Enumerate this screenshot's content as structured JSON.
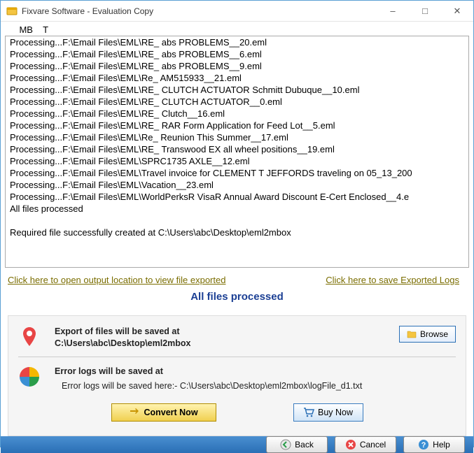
{
  "window": {
    "title": "Fixvare Software - Evaluation Copy"
  },
  "log": {
    "header_clip": "    MB    T",
    "lines": [
      "Processing...F:\\Email Files\\EML\\RE_ abs PROBLEMS__20.eml",
      "Processing...F:\\Email Files\\EML\\RE_ abs PROBLEMS__6.eml",
      "Processing...F:\\Email Files\\EML\\RE_ abs PROBLEMS__9.eml",
      "Processing...F:\\Email Files\\EML\\Re_ AM515933__21.eml",
      "Processing...F:\\Email Files\\EML\\RE_ CLUTCH ACTUATOR Schmitt Dubuque__10.eml",
      "Processing...F:\\Email Files\\EML\\RE_ CLUTCH ACTUATOR__0.eml",
      "Processing...F:\\Email Files\\EML\\RE_ Clutch__16.eml",
      "Processing...F:\\Email Files\\EML\\RE_ RAR Form Application for Feed Lot__5.eml",
      "Processing...F:\\Email Files\\EML\\Re_ Reunion This Summer__17.eml",
      "Processing...F:\\Email Files\\EML\\RE_ Transwood EX all wheel positions__19.eml",
      "Processing...F:\\Email Files\\EML\\SPRC1735 AXLE__12.eml",
      "Processing...F:\\Email Files\\EML\\Travel invoice for CLEMENT T JEFFORDS traveling on 05_13_200",
      "Processing...F:\\Email Files\\EML\\Vacation__23.eml",
      "Processing...F:\\Email Files\\EML\\WorldPerksR VisaR Annual Award Discount E-Cert Enclosed__4.e",
      "All files processed",
      "",
      "Required file successfully created at C:\\Users\\abc\\Desktop\\eml2mbox"
    ]
  },
  "links": {
    "open_output": "Click here to open output location to view file exported",
    "save_logs": "Click here to save Exported Logs"
  },
  "status": "All files processed",
  "export": {
    "label": "Export of files will be saved at",
    "path": "C:\\Users\\abc\\Desktop\\eml2mbox",
    "browse": "Browse"
  },
  "errorlog": {
    "label": "Error logs will be saved at",
    "path": "Error logs will be saved here:- C:\\Users\\abc\\Desktop\\eml2mbox\\logFile_d1.txt"
  },
  "actions": {
    "convert": "Convert Now",
    "buy": "Buy Now"
  },
  "footer": {
    "back": "Back",
    "cancel": "Cancel",
    "help": "Help"
  }
}
